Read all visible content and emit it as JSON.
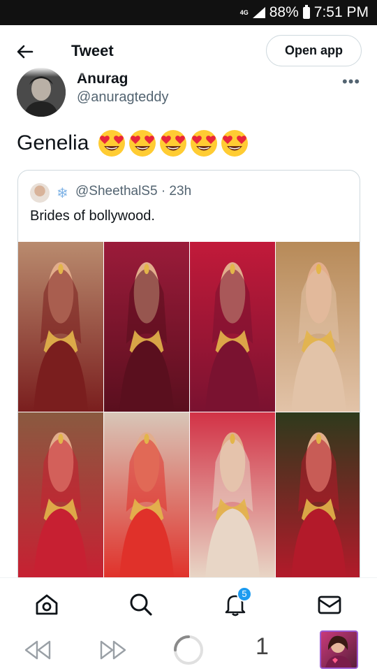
{
  "status_bar": {
    "network": "4G",
    "battery": "88%",
    "time": "7:51 PM"
  },
  "header": {
    "title": "Tweet",
    "open_app_label": "Open app"
  },
  "tweet": {
    "author_name": "Anurag",
    "author_handle": "@anuragteddy",
    "more_label": "•••",
    "text": "Genelia",
    "emoji_count": 5,
    "emoji_name": "smiling-face-with-heart-eyes"
  },
  "quote": {
    "handle": "@SheethalS5",
    "time": "· 23h",
    "badge": "❄",
    "text": "Brides of bollywood.",
    "images": [
      {
        "icon": "bride-photo",
        "colors": [
          "#b98b6e",
          "#7a1e1e"
        ]
      },
      {
        "icon": "bride-photo",
        "colors": [
          "#9b1b3a",
          "#5a0f1e"
        ]
      },
      {
        "icon": "bride-photo",
        "colors": [
          "#c21a3a",
          "#7a1230"
        ]
      },
      {
        "icon": "bride-photo",
        "colors": [
          "#b78a58",
          "#e2c3a8"
        ]
      },
      {
        "icon": "bride-photo",
        "colors": [
          "#8a5a40",
          "#c72032"
        ]
      },
      {
        "icon": "bride-photo",
        "colors": [
          "#d8c6b8",
          "#e0312a"
        ]
      },
      {
        "icon": "bride-photo",
        "colors": [
          "#d23246",
          "#e8d6c6"
        ]
      },
      {
        "icon": "bride-photo",
        "colors": [
          "#2e3a1c",
          "#b31a2a"
        ]
      }
    ]
  },
  "tabbar": {
    "items": [
      "home-icon",
      "search-icon",
      "notifications-icon",
      "messages-icon"
    ],
    "notification_count": "5"
  },
  "browser_bar": {
    "page_number": "1"
  },
  "colors": {
    "accent": "#1d9bf0",
    "text": "#0f1419",
    "secondary": "#536471",
    "border": "#cfd9de"
  }
}
